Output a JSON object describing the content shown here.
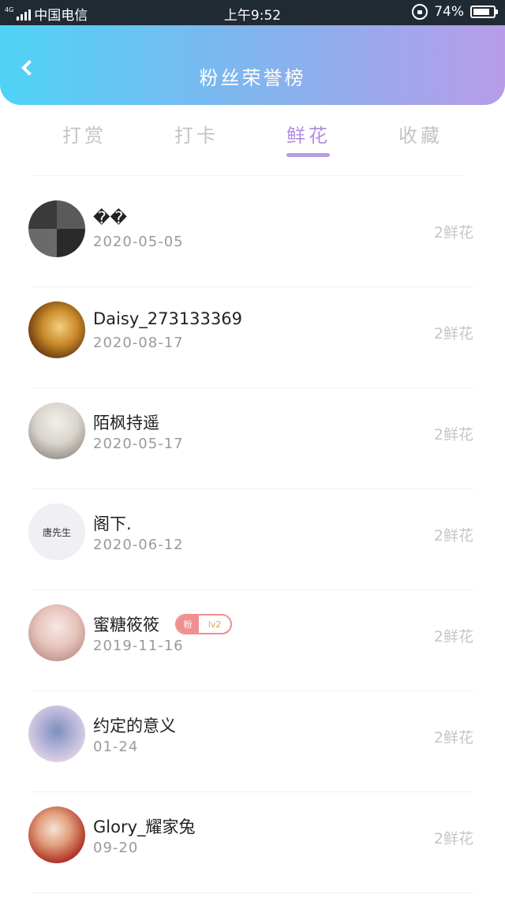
{
  "status_bar": {
    "network": "4G",
    "carrier": "中国电信",
    "time": "上午9:52",
    "battery": "74%"
  },
  "header": {
    "title": "粉丝荣誉榜",
    "gradient_start": "#4fd3f7",
    "gradient_end": "#b79ce8"
  },
  "tabs": [
    {
      "label": "打赏"
    },
    {
      "label": "打卡"
    },
    {
      "label": "鲜花",
      "active": true
    },
    {
      "label": "收藏"
    }
  ],
  "fans": [
    {
      "name": "��",
      "date": "2020-05-05",
      "count": "2鲜花"
    },
    {
      "name": "Daisy_273133369",
      "date": "2020-08-17",
      "count": "2鲜花"
    },
    {
      "name": "陌枫持遥",
      "date": "2020-05-17",
      "count": "2鲜花"
    },
    {
      "name": "阁下.",
      "date": "2020-06-12",
      "count": "2鲜花",
      "avatar_text": "唐先生"
    },
    {
      "name": "蜜糖筱筱",
      "date": "2019-11-16",
      "count": "2鲜花",
      "badge_left": "粉",
      "badge_right": "lv2"
    },
    {
      "name": "约定的意义",
      "date": "01-24",
      "count": "2鲜花"
    },
    {
      "name": "Glory_耀家兔",
      "date": "09-20",
      "count": "2鲜花"
    }
  ],
  "colors": {
    "accent": "#b48ee0",
    "badge": "#f08f8f"
  }
}
